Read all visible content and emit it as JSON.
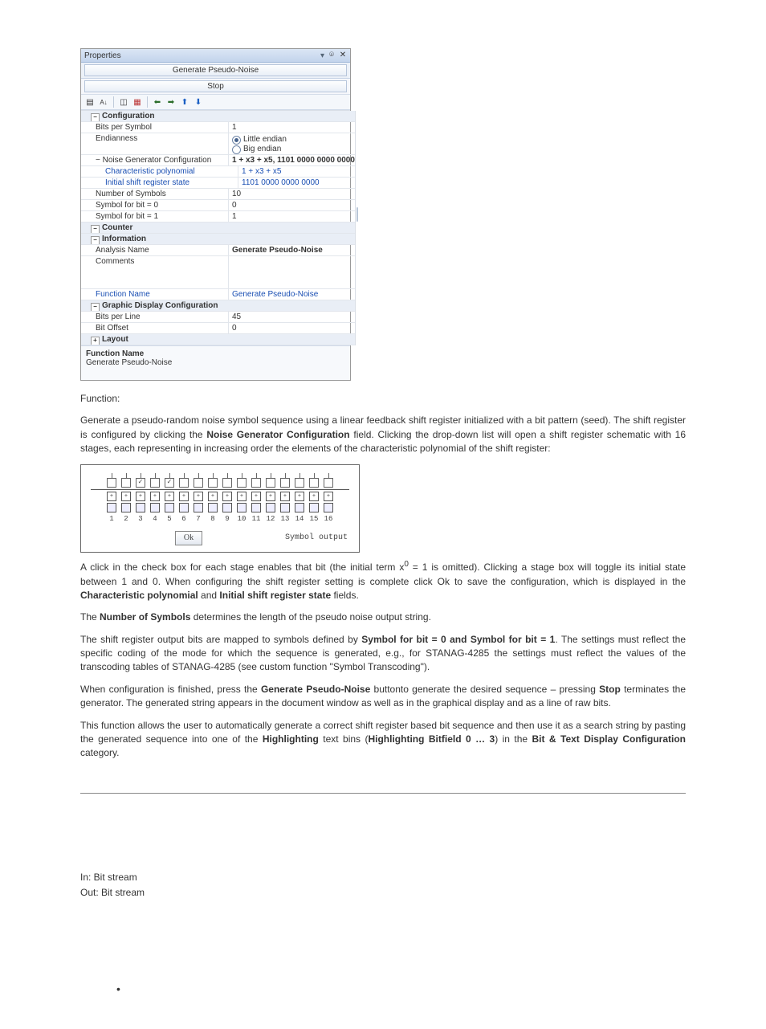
{
  "panel": {
    "title": "Properties",
    "btn_generate": "Generate Pseudo-Noise",
    "btn_stop": "Stop"
  },
  "sections": {
    "configuration": "Configuration",
    "counter": "Counter",
    "information": "Information",
    "graphic": "Graphic Display Configuration",
    "layout": "Layout"
  },
  "cfg": {
    "bits_per_symbol": {
      "label": "Bits per Symbol",
      "value": "1"
    },
    "endianness": {
      "label": "Endianness",
      "little": "Little endian",
      "big": "Big endian"
    },
    "noise_gen": {
      "label": "Noise Generator Configuration",
      "value": "1 + x3 + x5, 1101 0000 0000 0000"
    },
    "char_poly": {
      "label": "Characteristic polynomial",
      "value": "1 + x3 + x5"
    },
    "init_state": {
      "label": "Initial shift register state",
      "value": "1101 0000 0000 0000"
    },
    "num_symbols": {
      "label": "Number of Symbols",
      "value": "10"
    },
    "sym0": {
      "label": "Symbol for bit = 0",
      "value": "0"
    },
    "sym1": {
      "label": "Symbol for bit = 1",
      "value": "1"
    }
  },
  "info": {
    "analysis_name": {
      "label": "Analysis Name",
      "value": "Generate Pseudo-Noise"
    },
    "comments": {
      "label": "Comments",
      "value": ""
    },
    "function_name": {
      "label": "Function Name",
      "value": "Generate Pseudo-Noise"
    }
  },
  "gfx": {
    "bits_per_line": {
      "label": "Bits per Line",
      "value": "45"
    },
    "bit_offset": {
      "label": "Bit Offset",
      "value": "0"
    }
  },
  "desc": {
    "name_label": "Function Name",
    "name_value": "Generate Pseudo-Noise"
  },
  "prose": {
    "function_heading": "Function:",
    "p1a": "Generate a pseudo-random noise symbol sequence using a linear feedback shift register initialized with a bit pattern (seed). The shift register is configured by clicking the ",
    "p1b": "Noise Generator Configuration",
    "p1c": " field. Clicking the drop-down list will open a shift register schematic with 16 stages, each representing in increasing order the elements of the characteristic polynomial of the shift register:",
    "p2a": "A click in the check box for each stage enables that bit (the initial term x",
    "p2sup": "0",
    "p2b": " = 1 is omitted). Clicking a stage box will toggle its initial state between 1 and 0. When configuring the shift register setting is complete click Ok to save the configuration, which is displayed in the ",
    "p2c": "Characteristic polynomial",
    "p2d": " and ",
    "p2e": "Initial shift register state",
    "p2f": " fields.",
    "p3a": "The ",
    "p3b": "Number of Symbols",
    "p3c": " determines the length of the pseudo noise output string.",
    "p4a": "The shift register output bits are mapped to symbols defined by ",
    "p4b": "Symbol for bit = 0 and Symbol for bit = 1",
    "p4c": ". The settings must reflect the specific coding of the mode for which the sequence is generated, e.g., for STANAG-4285 the settings must reflect the values of the transcoding tables of STANAG-4285 (see custom function \"Symbol Transcoding\").",
    "p5a": "When configuration is finished, press the ",
    "p5b": "Generate Pseudo-Noise",
    "p5c": " buttonto generate the desired sequence – pressing ",
    "p5d": "Stop",
    "p5e": " terminates the generator. The generated string appears in the document window as well as in the graphical display and as a line of raw bits.",
    "p6a": "This function allows the user to automatically generate a correct shift register based bit sequence and then use it as a search string by pasting the generated sequence into one of the ",
    "p6b": "Highlighting",
    "p6c": " text bins (",
    "p6d": "Highlighting Bitfield 0 … 3",
    "p6e": ") in the ",
    "p6f": "Bit & Text Display Configuration",
    "p6g": " category."
  },
  "schematic": {
    "ok": "Ok",
    "symbol_output": "Symbol output",
    "stages": [
      "1",
      "2",
      "3",
      "4",
      "5",
      "6",
      "7",
      "8",
      "9",
      "10",
      "11",
      "12",
      "13",
      "14",
      "15",
      "16"
    ],
    "checked": [
      3,
      5
    ]
  },
  "io": {
    "in": "In: Bit stream",
    "out": "Out: Bit stream"
  }
}
